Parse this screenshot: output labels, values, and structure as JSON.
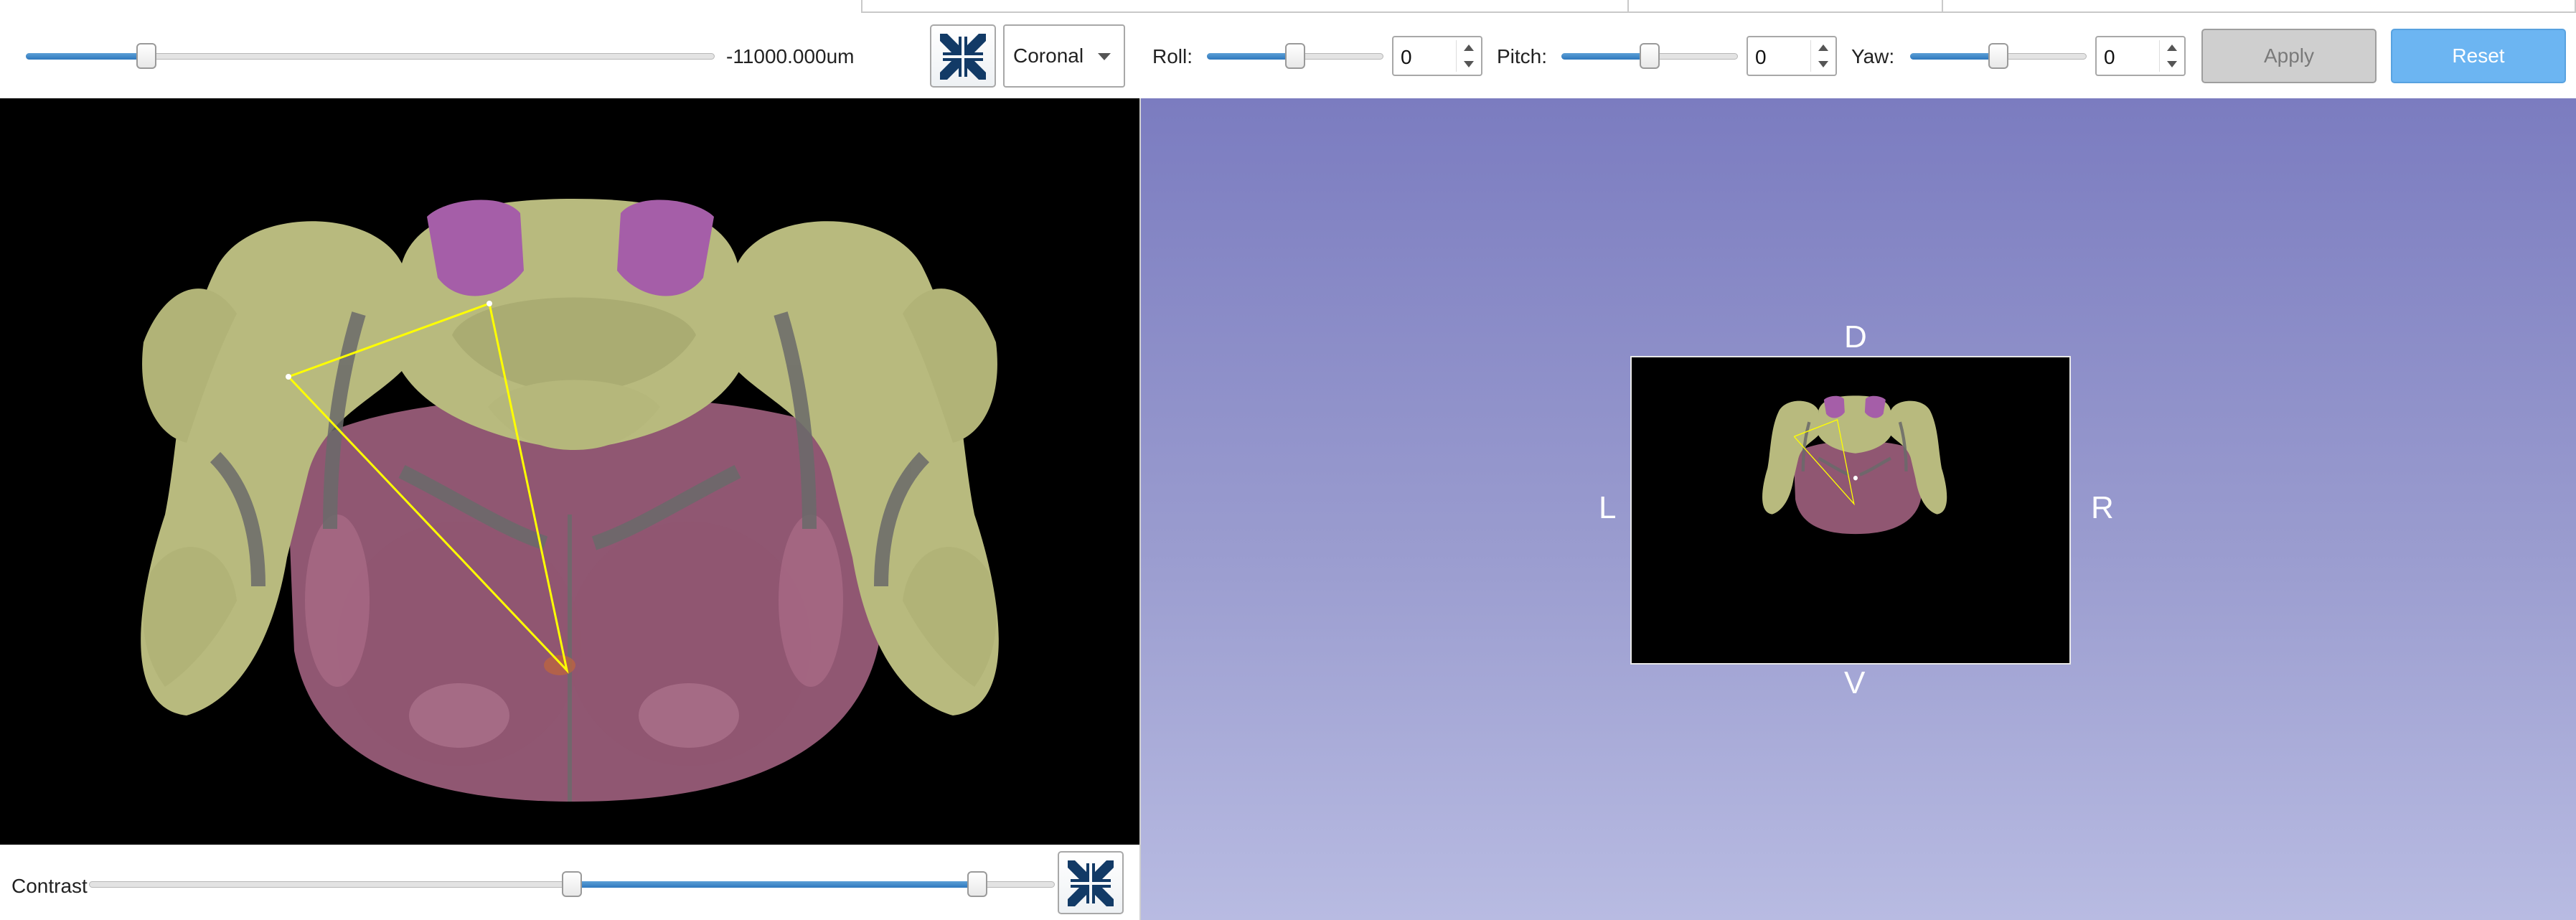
{
  "toolbar": {
    "depth_slider": {
      "value_fraction": 0.175
    },
    "depth_readout": "-11000.000um",
    "orientation_select": {
      "selected": "Coronal"
    },
    "roll": {
      "label": "Roll:",
      "value": "0",
      "slider_fraction": 0.5
    },
    "pitch": {
      "label": "Pitch:",
      "value": "0",
      "slider_fraction": 0.5
    },
    "yaw": {
      "label": "Yaw:",
      "value": "0",
      "slider_fraction": 0.5
    },
    "apply_label": "Apply",
    "reset_label": "Reset"
  },
  "view3d": {
    "orientation": {
      "dorsal": "D",
      "ventral": "V",
      "left": "L",
      "right": "R"
    }
  },
  "contrast": {
    "label": "Contrast",
    "range_low_fraction": 0.5,
    "range_high_fraction": 0.92
  },
  "colors": {
    "slider_fill": "#2f78bd",
    "reset_button": "#6cb5f2",
    "view3d_top": "#7b7cc0",
    "view3d_bottom": "#b8bbe2",
    "atlas_region_yellow": "#b8ba7e",
    "atlas_region_magenta": "#a55ea8",
    "atlas_region_pink": "#a0607e",
    "probe_line": "#ffff00"
  },
  "icons": [
    "fit-view-icon",
    "dropdown-arrow-icon",
    "spin-up-icon",
    "spin-down-icon"
  ]
}
